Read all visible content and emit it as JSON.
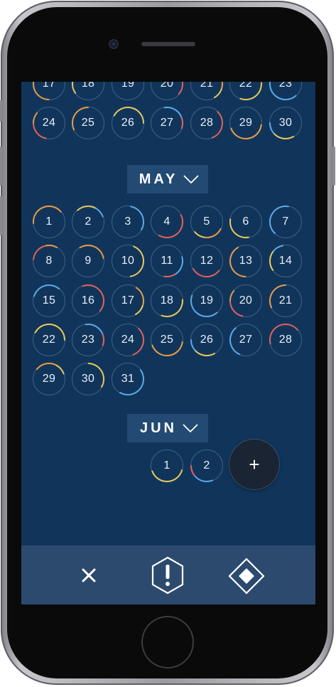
{
  "prev_month_tail": {
    "partial_row": [
      "17",
      "18",
      "19",
      "20",
      "21",
      "22",
      "23"
    ],
    "last_row": [
      "24",
      "25",
      "26",
      "27",
      "28",
      "29",
      "30"
    ]
  },
  "may": {
    "label": "MAY",
    "days": [
      "1",
      "2",
      "3",
      "4",
      "5",
      "6",
      "7",
      "8",
      "9",
      "10",
      "11",
      "12",
      "13",
      "14",
      "15",
      "16",
      "17",
      "18",
      "19",
      "20",
      "21",
      "22",
      "23",
      "24",
      "25",
      "26",
      "27",
      "28",
      "29",
      "30",
      "31"
    ]
  },
  "jun": {
    "label": "JUN",
    "days": [
      "1",
      "2"
    ]
  },
  "fab": {
    "label": "+",
    "icon": "plus-icon"
  },
  "toolbar": {
    "close_icon": "close-icon",
    "alert_icon": "alert-hexagon-icon",
    "diamond_icon": "diamond-icon"
  },
  "colors": {
    "screen_bg": "#11355a",
    "pill_bg": "#224a72",
    "toolbar_bg": "#2c4a6d",
    "fab_bg": "#1b2433",
    "arc_red": "#e0605a",
    "arc_orange": "#e79a4a",
    "arc_yellow": "#e8c85a",
    "arc_blue": "#5aa8e6"
  }
}
